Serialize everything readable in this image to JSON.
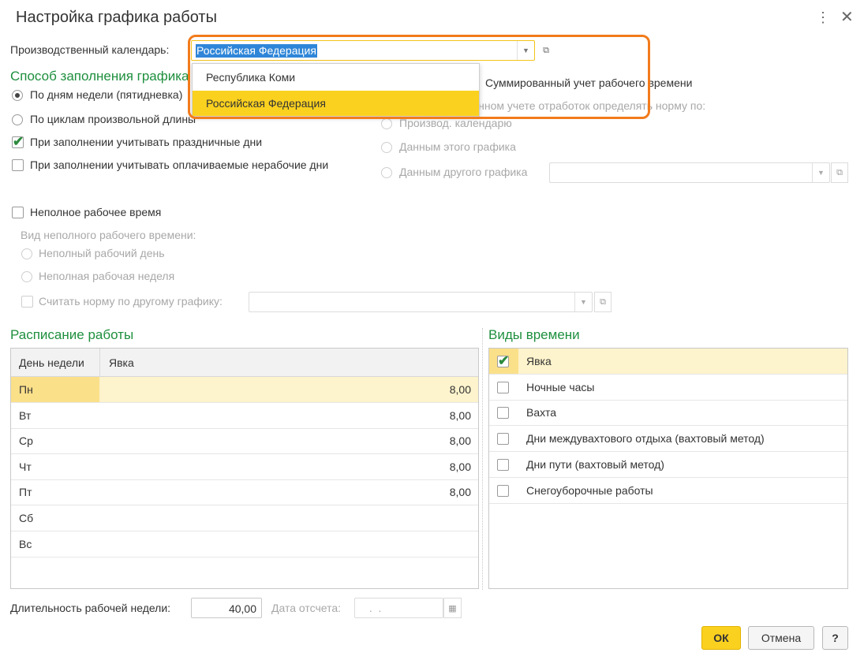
{
  "window": {
    "title": "Настройка графика работы"
  },
  "calendar": {
    "label": "Производственный календарь:",
    "value": "Российская Федерация",
    "options": [
      "Республика Коми",
      "Российская Федерация"
    ]
  },
  "fill_method": {
    "heading": "Способ заполнения графика",
    "by_weekdays": "По дням недели (пятидневка)",
    "by_cycles": "По циклам произвольной длины",
    "holidays_label": "При заполнении учитывать праздничные дни",
    "paid_nonwork_label": "При заполнении учитывать оплачиваемые нерабочие дни"
  },
  "summary": {
    "checkbox_label": "Суммированный учет рабочего времени",
    "norm_label": "При суммированном учете отработок определять норму по:",
    "opt_calendar": "Производ. календарю",
    "opt_this": "Данным этого графика",
    "opt_other": "Данным другого графика"
  },
  "part_time": {
    "label": "Неполное рабочее время",
    "kind_label": "Вид неполного рабочего времени:",
    "day": "Неполный рабочий день",
    "week": "Неполная рабочая неделя",
    "norm_other": "Считать норму по другому графику:"
  },
  "schedule": {
    "heading": "Расписание работы",
    "col_day": "День недели",
    "col_attendance": "Явка",
    "rows": [
      {
        "day": "Пн",
        "value": "8,00"
      },
      {
        "day": "Вт",
        "value": "8,00"
      },
      {
        "day": "Ср",
        "value": "8,00"
      },
      {
        "day": "Чт",
        "value": "8,00"
      },
      {
        "day": "Пт",
        "value": "8,00"
      },
      {
        "day": "Сб",
        "value": ""
      },
      {
        "day": "Вс",
        "value": ""
      }
    ]
  },
  "time_types": {
    "heading": "Виды времени",
    "items": [
      {
        "label": "Явка",
        "checked": true
      },
      {
        "label": "Ночные часы",
        "checked": false
      },
      {
        "label": "Вахта",
        "checked": false
      },
      {
        "label": "Дни междувахтового отдыха (вахтовый метод)",
        "checked": false
      },
      {
        "label": "Дни пути (вахтовый метод)",
        "checked": false
      },
      {
        "label": "Снегоуборочные работы",
        "checked": false
      }
    ]
  },
  "footer": {
    "week_duration_label": "Длительность рабочей недели:",
    "week_duration_value": "40,00",
    "ref_date_label": "Дата отсчета:",
    "ref_date_value": " .  . ",
    "ok": "ОК",
    "cancel": "Отмена",
    "help": "?"
  },
  "colors": {
    "accent_green": "#1e8f3e",
    "selection_yellow": "#fbd11f",
    "highlight_orange": "#f27b1c",
    "text_selection_blue": "#2f86d8"
  }
}
